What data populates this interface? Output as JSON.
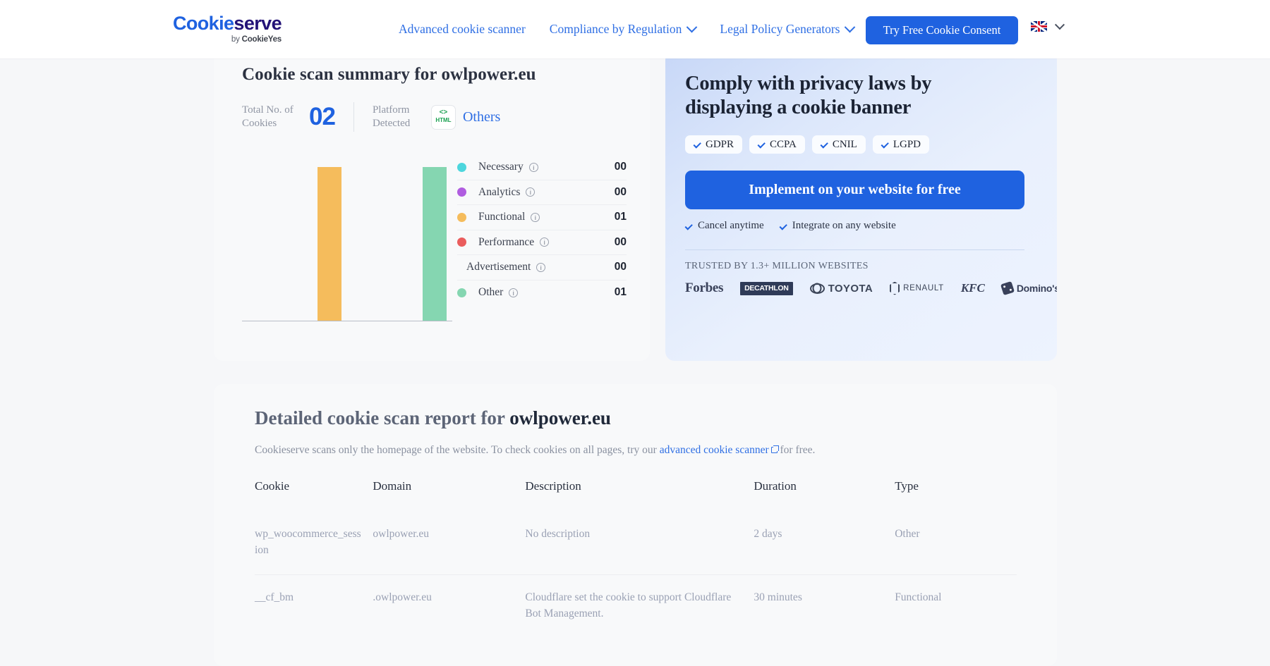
{
  "header": {
    "logo": {
      "part1": "Cookie",
      "part2": "serve",
      "byline_prefix": "by ",
      "byline_brand": "CookieYes"
    },
    "nav": [
      {
        "label": "Advanced cookie scanner",
        "has_dropdown": false
      },
      {
        "label": "Compliance by Regulation",
        "has_dropdown": true
      },
      {
        "label": "Legal Policy Generators",
        "has_dropdown": true
      }
    ],
    "cta_label": "Try Free Cookie Consent",
    "language_icon": "uk-flag-icon"
  },
  "summary": {
    "title": "Cookie scan summary for owlpower.eu",
    "total_label": "Total No. of Cookies",
    "total_value": "02",
    "platform_label": "Platform Detected",
    "platform_badge": "HTML",
    "platform_badge_glyph": "<>",
    "platform_value": "Others",
    "legend": [
      {
        "name": "Necessary",
        "value": "00",
        "color": "#4dd6dd",
        "has_dot": true
      },
      {
        "name": "Analytics",
        "value": "00",
        "color": "#b05de0",
        "has_dot": true
      },
      {
        "name": "Functional",
        "value": "01",
        "color": "#f5bc5c",
        "has_dot": true
      },
      {
        "name": "Performance",
        "value": "00",
        "color": "#ea5d5d",
        "has_dot": true
      },
      {
        "name": "Advertisement",
        "value": "00",
        "color": "transparent",
        "has_dot": false
      },
      {
        "name": "Other",
        "value": "01",
        "color": "#85d6b1",
        "has_dot": true
      }
    ],
    "info_glyph": "i"
  },
  "chart_data": {
    "type": "bar",
    "title": "Cookie scan summary for owlpower.eu",
    "categories": [
      "Necessary",
      "Analytics",
      "Functional",
      "Performance",
      "Advertisement",
      "Other"
    ],
    "values": [
      0,
      0,
      1,
      0,
      0,
      1
    ],
    "colors": [
      "#4dd6dd",
      "#b05de0",
      "#f5bc5c",
      "#ea5d5d",
      "#cbd2dc",
      "#85d6b1"
    ],
    "xlabel": "",
    "ylabel": "",
    "ylim": [
      0,
      1
    ],
    "grid": false,
    "legend_position": "right",
    "total": 2
  },
  "cta": {
    "heading": "Comply with privacy laws by displaying a cookie banner",
    "chips": [
      "GDPR",
      "CCPA",
      "CNIL",
      "LGPD"
    ],
    "button_label": "Implement on your website for free",
    "sub_items": [
      "Cancel anytime",
      "Integrate on any website"
    ],
    "trusted_label": "TRUSTED BY 1.3+ MILLION WEBSITES",
    "brands": [
      "Forbes",
      "DECATHLON",
      "TOYOTA",
      "RENAULT",
      "KFC",
      "Domino's"
    ],
    "accent_color": "#1f62e0"
  },
  "report": {
    "title_prefix": "Detailed cookie scan report for ",
    "title_domain": "owlpower.eu",
    "note_before": "Cookieserve scans only the homepage of the website. To check cookies on all pages, try our ",
    "note_link": "advanced cookie scanner",
    "note_after": " for free.",
    "columns": [
      "Cookie",
      "Domain",
      "Description",
      "Duration",
      "Type"
    ],
    "rows": [
      {
        "cookie": "wp_woocommerce_session",
        "domain": "owlpower.eu",
        "description": "No description",
        "duration": "2 days",
        "type": "Other"
      },
      {
        "cookie": "__cf_bm",
        "domain": ".owlpower.eu",
        "description": "Cloudflare set the cookie to support Cloudflare Bot Management.",
        "duration": "30 minutes",
        "type": "Functional"
      }
    ]
  }
}
